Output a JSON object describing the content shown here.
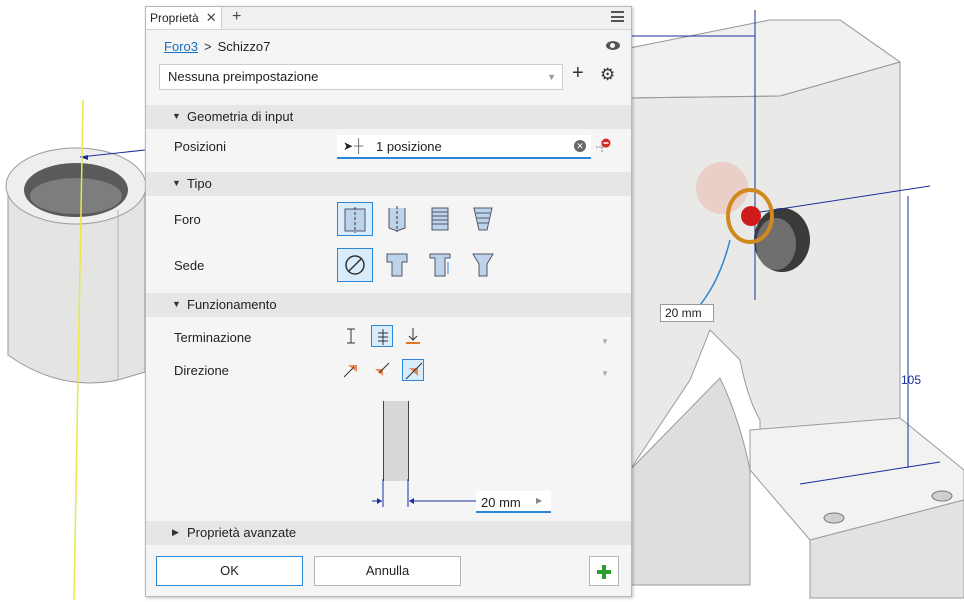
{
  "panel": {
    "tab_label": "Proprietà",
    "tab_close": "✕",
    "tab_add": "+",
    "breadcrumb": {
      "feature": "Foro3",
      "separator": ">",
      "sketch": "Schizzo7"
    },
    "preset": {
      "value": "Nessuna preimpostazione",
      "add": "+",
      "caret": "▼"
    },
    "sections": {
      "input_geometry": {
        "title": "Geometria di input",
        "arrow": "▼"
      },
      "type": {
        "title": "Tipo",
        "arrow": "▼"
      },
      "behavior": {
        "title": "Funzionamento",
        "arrow": "▼"
      },
      "advanced": {
        "title": "Proprietà avanzate",
        "arrow": "▶"
      }
    },
    "fields": {
      "positions_label": "Posizioni",
      "positions_value": "1 posizione",
      "hole_label": "Foro",
      "seat_label": "Sede",
      "termination_label": "Terminazione",
      "direction_label": "Direzione",
      "diameter_value": "20 mm"
    },
    "buttons": {
      "ok": "OK",
      "cancel": "Annulla"
    },
    "icons": [
      "gear-icon",
      "eye-icon",
      "menu-icon",
      "cursor-icon",
      "clear-icon",
      "remove-position-icon"
    ]
  },
  "viewport": {
    "dim_diameter": "20 mm",
    "dim_height": "105"
  }
}
